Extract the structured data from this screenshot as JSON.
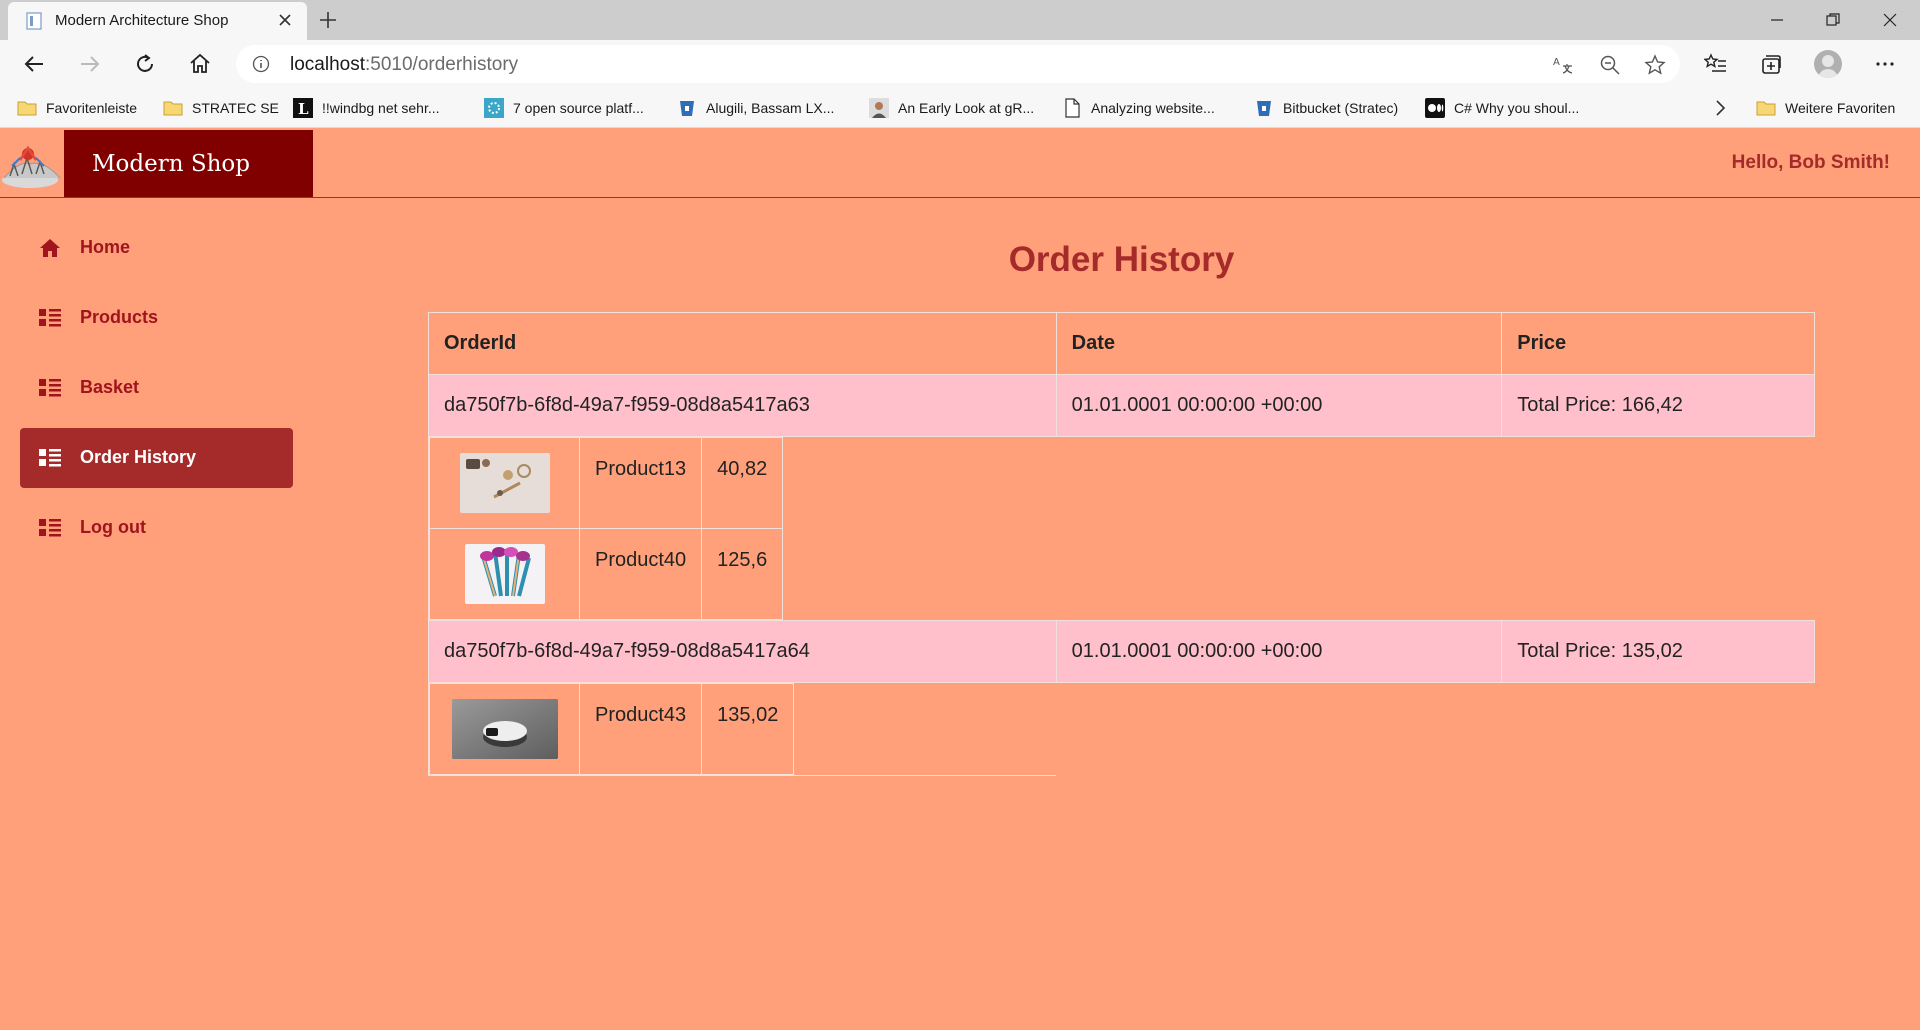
{
  "browser": {
    "tab_title": "Modern Architecture Shop",
    "url_host": "localhost",
    "url_path": ":5010/orderhistory",
    "favorites": [
      {
        "label": "Favoritenleiste",
        "icon": "folder-icon"
      },
      {
        "label": "STRATEC SE",
        "icon": "folder-icon"
      },
      {
        "label": "!!windbg  net sehr...",
        "icon": "l-site-icon"
      },
      {
        "label": "7 open source platf...",
        "icon": "dots-site-icon"
      },
      {
        "label": "Alugili, Bassam   LX...",
        "icon": "bucket-site-icon"
      },
      {
        "label": "An Early Look at gR...",
        "icon": "person-site-icon"
      },
      {
        "label": "Analyzing website...",
        "icon": "page-icon"
      },
      {
        "label": "Bitbucket (Stratec)",
        "icon": "bucket-site-icon"
      },
      {
        "label": "C#  Why you shoul...",
        "icon": "medium-site-icon"
      }
    ],
    "more_favorites": "Weitere Favoriten"
  },
  "header": {
    "brand": "Modern Shop",
    "greeting": "Hello, Bob Smith!"
  },
  "nav": [
    {
      "label": "Home",
      "icon": "home-icon"
    },
    {
      "label": "Products",
      "icon": "list-icon"
    },
    {
      "label": "Basket",
      "icon": "list-icon"
    },
    {
      "label": "Order History",
      "icon": "list-icon",
      "active": true
    },
    {
      "label": "Log out",
      "icon": "list-icon"
    }
  ],
  "page": {
    "title": "Order History",
    "columns": [
      "OrderId",
      "Date",
      "Price"
    ],
    "orders": [
      {
        "id": "da750f7b-6f8d-49a7-f959-08d8a5417a63",
        "date": "01.01.0001 00:00:00 +00:00",
        "price": "Total Price: 166,42",
        "items": [
          {
            "name": "Product13",
            "price": "40,82",
            "image": "accessories-photo"
          },
          {
            "name": "Product40",
            "price": "125,6",
            "image": "makeup-brushes-photo"
          }
        ]
      },
      {
        "id": "da750f7b-6f8d-49a7-f959-08d8a5417a64",
        "date": "01.01.0001 00:00:00 +00:00",
        "price": "Total Price: 135,02",
        "items": [
          {
            "name": "Product43",
            "price": "135,02",
            "image": "device-photo"
          }
        ]
      }
    ]
  },
  "colors": {
    "page_background": "#ffa07a",
    "brand_background": "#800000",
    "accent": "#a52a2a",
    "order_row": "#ffc0cb"
  }
}
